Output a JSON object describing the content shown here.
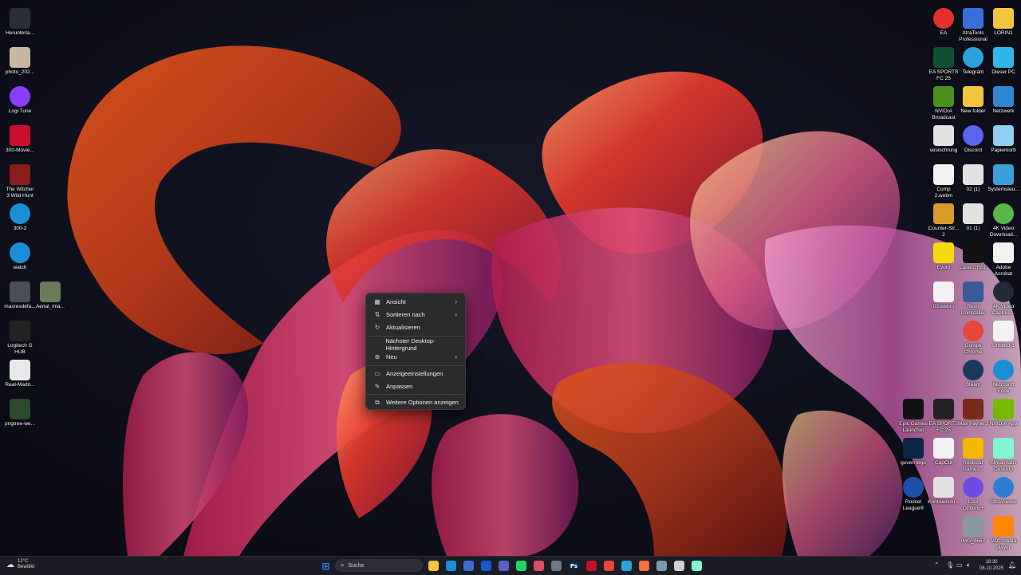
{
  "desktop_left": [
    {
      "label": "Herunterla...",
      "icon": "download-icon",
      "color": "#2a2d3a"
    },
    {
      "label": "photo_202...",
      "icon": "photo-thumbnail-icon",
      "color": "#c9b7a5"
    },
    {
      "label": "Logi Tune",
      "icon": "logi-tune-icon",
      "color": "#8b3dff"
    },
    {
      "label": "300-Movie...",
      "icon": "movie-icon",
      "color": "#c8102e"
    },
    {
      "label": "The Witcher 3 Wild Hunt",
      "icon": "witcher-icon",
      "color": "#8a1c1c"
    },
    {
      "label": "300-2",
      "icon": "edge-icon",
      "color": "#1a8fd6"
    },
    {
      "label": "watch",
      "icon": "edge-icon",
      "color": "#1a8fd6"
    },
    {
      "label": "maxresdefa...",
      "icon": "image-thumbnail-icon",
      "color": "#4a4f55"
    },
    {
      "label": "Aerial_ima...",
      "icon": "image-thumbnail-icon",
      "color": "#6b7a5a"
    },
    {
      "label": "Logitech G HUB",
      "icon": "logitech-g-icon",
      "color": "#222222"
    },
    {
      "label": "Real-Madri...",
      "icon": "image-thumbnail-icon",
      "color": "#e8e8e8"
    },
    {
      "label": "pngtree-we...",
      "icon": "image-thumbnail-icon",
      "color": "#2a4a2a"
    }
  ],
  "desktop_right": [
    {
      "label": "EA",
      "icon": "ea-icon",
      "color": "#e4312b"
    },
    {
      "label": "XtraTools Professional",
      "icon": "xtratools-icon",
      "color": "#3a6fd8"
    },
    {
      "label": "LORIN1",
      "icon": "folder-icon",
      "color": "#f3c53f"
    },
    {
      "label": "EA SPORTS FC 25",
      "icon": "ea-fc-icon",
      "color": "#0f5132"
    },
    {
      "label": "Telegram",
      "icon": "telegram-icon",
      "color": "#2aa3dd"
    },
    {
      "label": "Dieser PC",
      "icon": "monitor-icon",
      "color": "#31b6e8"
    },
    {
      "label": "NVIDIA Broadcast",
      "icon": "nvidia-broadcast-icon",
      "color": "#4b8f1d"
    },
    {
      "label": "New folder",
      "icon": "folder-icon",
      "color": "#f3c53f"
    },
    {
      "label": "Netzwerk",
      "icon": "network-icon",
      "color": "#2f86d1"
    },
    {
      "label": "vesischrung",
      "icon": "pdf-icon",
      "color": "#e2e2e2"
    },
    {
      "label": "Discord",
      "icon": "discord-icon",
      "color": "#5865f2"
    },
    {
      "label": "Papierkorb",
      "icon": "recycle-bin-icon",
      "color": "#8fd0f0"
    },
    {
      "label": "Comp 2.webm",
      "icon": "file-icon",
      "color": "#f2f2f2"
    },
    {
      "label": "02 (1)",
      "icon": "pdf-icon",
      "color": "#e2e2e2"
    },
    {
      "label": "Systemsteu...",
      "icon": "control-panel-icon",
      "color": "#3aa0d8"
    },
    {
      "label": "Counter-Str... 2",
      "icon": "counter-strike-icon",
      "color": "#d99a2b"
    },
    {
      "label": "01 (1)",
      "icon": "pdf-icon",
      "color": "#e2e2e2"
    },
    {
      "label": "4K Video Download...",
      "icon": "4k-video-icon",
      "color": "#56b947"
    },
    {
      "label": "Evoto",
      "icon": "evoto-icon",
      "color": "#f5d90a"
    },
    {
      "label": "LaserGRBL",
      "icon": "lasergrbl-icon",
      "color": "#111111"
    },
    {
      "label": "Adobe Acrobat",
      "icon": "acrobat-icon",
      "color": "#f2f2f2"
    },
    {
      "label": "03.webm",
      "icon": "file-icon",
      "color": "#f2f2f2"
    },
    {
      "label": "Revo Uninstaller",
      "icon": "revo-icon",
      "color": "#3a5a9a"
    },
    {
      "label": "4K Video Capture...",
      "icon": "4k-capture-icon",
      "color": "#222a3a"
    },
    {
      "label": "Google Chrome",
      "icon": "chrome-icon",
      "color": "#e8453c"
    },
    {
      "label": "Untitled-1",
      "icon": "file-icon",
      "color": "#f2f2f2"
    },
    {
      "label": "Steam",
      "icon": "steam-icon",
      "color": "#1b3a5c"
    },
    {
      "label": "Microsoft Edge",
      "icon": "edge-icon",
      "color": "#1a8fd6"
    },
    {
      "label": "Epic Games Launcher",
      "icon": "epic-icon",
      "color": "#111111"
    },
    {
      "label": "EA SPORTS FC 25",
      "icon": "ea-fc-icon",
      "color": "#222222"
    },
    {
      "label": "Max Payne 3",
      "icon": "maxpayne-icon",
      "color": "#7a2a1a"
    },
    {
      "label": "NVIDIA App",
      "icon": "nvidia-icon",
      "color": "#76b900"
    },
    {
      "label": "guven logo",
      "icon": "photoshop-icon",
      "color": "#0b2545"
    },
    {
      "label": "CapCut",
      "icon": "capcut-icon",
      "color": "#f2f2f2"
    },
    {
      "label": "Rockstar Games...",
      "icon": "rockstar-icon",
      "color": "#f4b800"
    },
    {
      "label": "Streamlabs Desktop",
      "icon": "streamlabs-icon",
      "color": "#80f5d2"
    },
    {
      "label": "Rocket League®",
      "icon": "rocket-league-icon",
      "color": "#1e4fa8"
    },
    {
      "label": "Kontoauszu...",
      "icon": "pdf-icon",
      "color": "#e2e2e2"
    },
    {
      "label": "Logi Options+",
      "icon": "logi-options-icon",
      "color": "#6b4de6"
    },
    {
      "label": "UltraViewer",
      "icon": "ultraviewer-icon",
      "color": "#2d7fd6"
    },
    {
      "label": "IMG_4667",
      "icon": "image-thumbnail-icon",
      "color": "#8a9aa0"
    },
    {
      "label": "VLC media player",
      "icon": "vlc-icon",
      "color": "#ff8800"
    }
  ],
  "context_menu": {
    "items": [
      {
        "label": "Ansicht",
        "icon": "grid-icon",
        "glyph": "▦",
        "submenu": true
      },
      {
        "label": "Sortieren nach",
        "icon": "sort-icon",
        "glyph": "⇅",
        "submenu": true
      },
      {
        "label": "Aktualisieren",
        "icon": "refresh-icon",
        "glyph": "↻",
        "submenu": false
      },
      {
        "label": "Nächster Desktop-Hintergrund",
        "icon": "",
        "glyph": "",
        "submenu": false
      },
      {
        "label": "Neu",
        "icon": "plus-circle-icon",
        "glyph": "⊕",
        "submenu": true
      },
      {
        "label": "Anzeigeeinstellungen",
        "icon": "display-icon",
        "glyph": "▭",
        "submenu": false
      },
      {
        "label": "Anpassen",
        "icon": "brush-icon",
        "glyph": "✎",
        "submenu": false
      },
      {
        "label": "Weitere Optionen anzeigen",
        "icon": "more-options-icon",
        "glyph": "⧉",
        "submenu": false
      }
    ]
  },
  "taskbar": {
    "weather_temp": "12°C",
    "weather_desc": "Bewölkt",
    "search_placeholder": "Suche",
    "time": "18:30",
    "date": "06.10.2025",
    "apps": [
      {
        "icon": "windows-start-icon",
        "color": "#1e90ff",
        "glyph": "⊞"
      },
      {
        "icon": "file-explorer-icon",
        "color": "#f3c53f",
        "glyph": ""
      },
      {
        "icon": "edge-icon",
        "color": "#1a8fd6",
        "glyph": ""
      },
      {
        "icon": "store-icon",
        "color": "#3a6fd8",
        "glyph": ""
      },
      {
        "icon": "outlook-icon",
        "color": "#0f5bd1",
        "glyph": ""
      },
      {
        "icon": "teams-icon",
        "color": "#5b5fc7",
        "glyph": ""
      },
      {
        "icon": "whatsapp-icon",
        "color": "#25d366",
        "glyph": ""
      },
      {
        "icon": "app-icon",
        "color": "#e04a6a",
        "glyph": ""
      },
      {
        "icon": "photos-icon",
        "color": "#6b7a8a",
        "glyph": ""
      },
      {
        "icon": "photoshop-icon",
        "color": "#0b2545",
        "glyph": "Ps"
      },
      {
        "icon": "adobe-icon",
        "color": "#c8102e",
        "glyph": ""
      },
      {
        "icon": "chrome-icon",
        "color": "#e8453c",
        "glyph": ""
      },
      {
        "icon": "telegram-icon",
        "color": "#2aa3dd",
        "glyph": ""
      },
      {
        "icon": "firefox-icon",
        "color": "#ff7139",
        "glyph": ""
      },
      {
        "icon": "ai-app-icon",
        "color": "#7a9ab0",
        "glyph": ""
      },
      {
        "icon": "chatgpt-icon",
        "color": "#d0d0d0",
        "glyph": ""
      },
      {
        "icon": "streamlabs-icon",
        "color": "#80f5d2",
        "glyph": ""
      }
    ]
  }
}
